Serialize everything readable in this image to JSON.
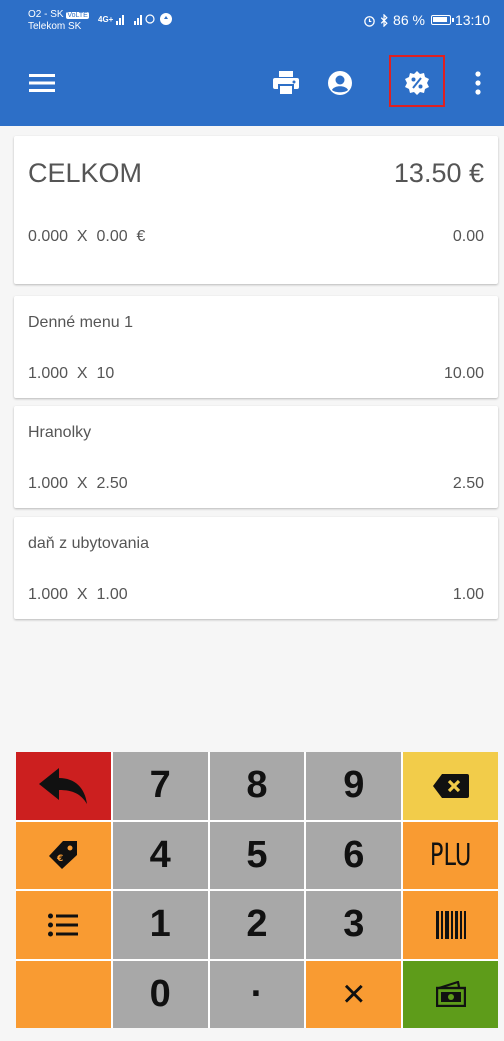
{
  "status": {
    "carrier1": "O2 - SK",
    "volte": "VoLTE",
    "carrier2": "Telekom SK",
    "network": "4G+",
    "battery": "86 %",
    "time": "13:10"
  },
  "toolbar": {
    "icons": [
      "menu-icon",
      "print-icon",
      "account-icon",
      "discount-badge-icon",
      "more-vert-icon"
    ]
  },
  "total": {
    "label": "CELKOM",
    "value": "13.50 €",
    "qty_line": "0.000  X  0.00  €",
    "qty_sum": "0.00"
  },
  "items": [
    {
      "name": "Denné menu 1",
      "qty": "1.000  X  10",
      "sum": "10.00"
    },
    {
      "name": "Hranolky",
      "qty": "1.000  X  2.50",
      "sum": "2.50"
    },
    {
      "name": "daň z ubytovania",
      "qty": "1.000  X  1.00",
      "sum": "1.00"
    }
  ],
  "keypad": {
    "digits": [
      "7",
      "8",
      "9",
      "4",
      "5",
      "6",
      "1",
      "2",
      "3",
      "0"
    ],
    "dot": "·",
    "multiply": "×",
    "plu": "PLU",
    "colors": {
      "red": "#cc1f1f",
      "gray": "#a8a8a8",
      "orange": "#f99b32",
      "yellow": "#f2cc4a",
      "green": "#5e9c1a"
    }
  },
  "colors": {
    "primary": "#2d6fc7",
    "highlight": "#e02020"
  }
}
